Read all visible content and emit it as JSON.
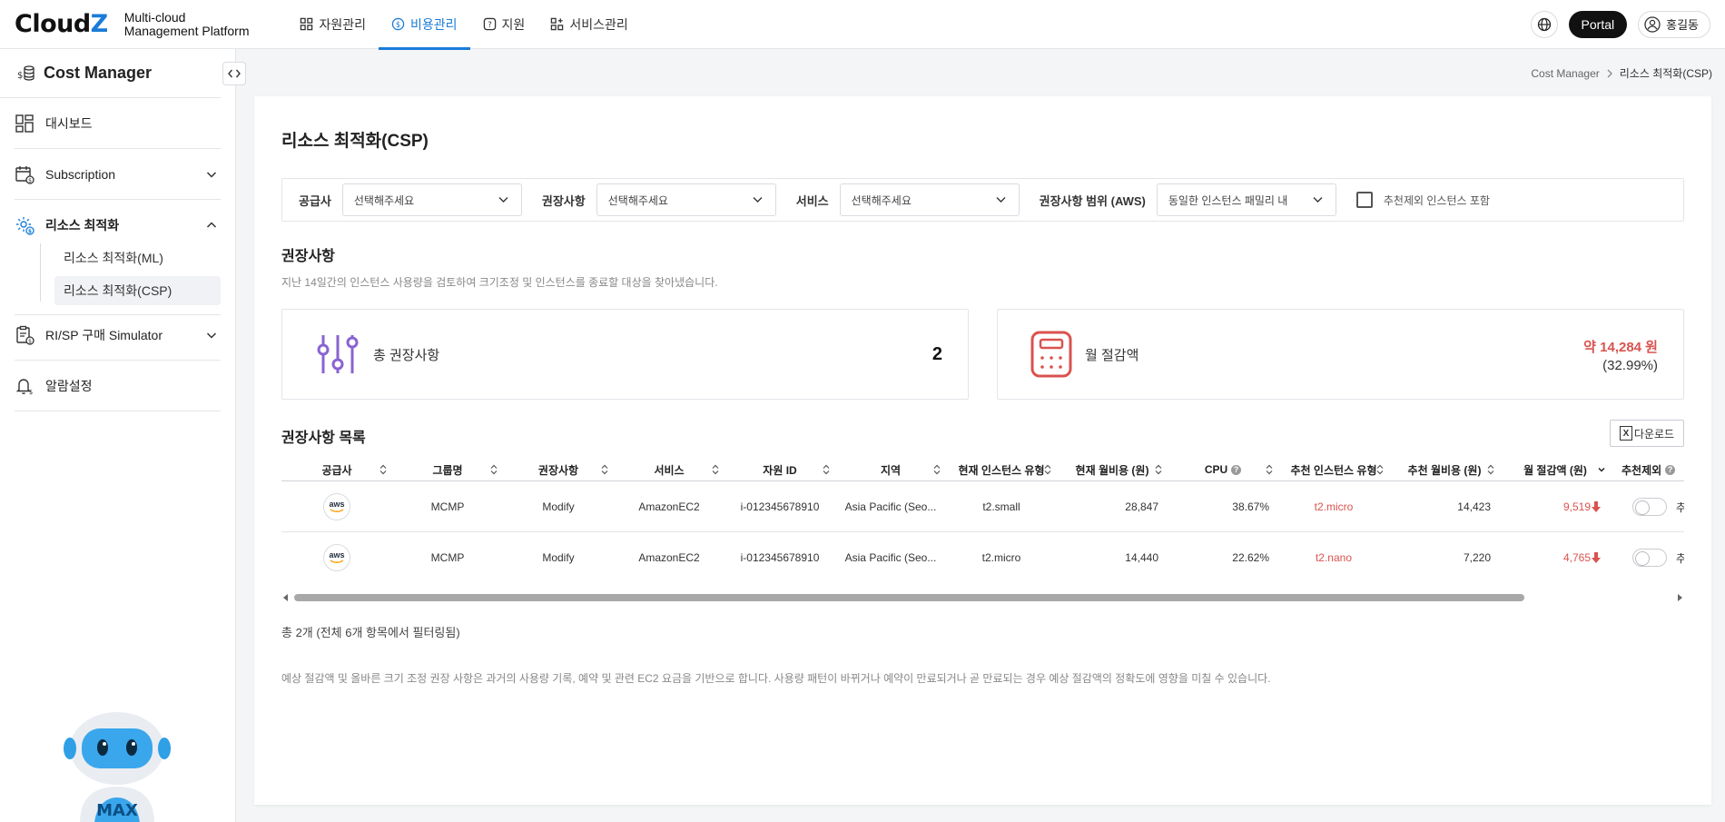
{
  "brand": {
    "logo_main": "Cloud",
    "logo_z": "Z",
    "sub_line1": "Multi-cloud",
    "sub_line2": "Management Platform"
  },
  "gnb": [
    {
      "label": "자원관리",
      "active": false
    },
    {
      "label": "비용관리",
      "active": true
    },
    {
      "label": "지원",
      "active": false
    },
    {
      "label": "서비스관리",
      "active": false
    }
  ],
  "top_right": {
    "portal": "Portal",
    "user": "홍길동"
  },
  "sidebar": {
    "title": "Cost Manager",
    "items": [
      {
        "label": "대시보드"
      },
      {
        "label": "Subscription"
      },
      {
        "label": "리소스 최적화"
      },
      {
        "label": "RI/SP 구매 Simulator"
      },
      {
        "label": "알람설정"
      }
    ],
    "sub_items": [
      "리소스 최적화(ML)",
      "리소스 최적화(CSP)"
    ],
    "mascot_label": "MAX"
  },
  "breadcrumb": {
    "root": "Cost Manager",
    "current": "리소스 최적화(CSP)"
  },
  "page": {
    "title": "리소스 최적화(CSP)",
    "filters": {
      "provider_label": "공급사",
      "provider_value": "선택해주세요",
      "reco_label": "권장사항",
      "reco_value": "선택해주세요",
      "service_label": "서비스",
      "service_value": "선택해주세요",
      "scope_label": "권장사항 범위 (AWS)",
      "scope_value": "동일한 인스턴스 패밀리 내",
      "exclude_label": "추천제외 인스턴스 포함"
    },
    "reco_section": {
      "title": "권장사항",
      "desc": "지난 14일간의 인스턴스 사용량을 검토하여 크기조정 및 인스턴스를 종료할 대상을 찾아냈습니다.",
      "total_label": "총 권장사항",
      "total_value": "2",
      "saving_label": "월 절감액",
      "saving_amount": "약 14,284 원",
      "saving_pct": "(32.99%)"
    },
    "list": {
      "title": "권장사항 목록",
      "download": "다운로드",
      "headers": [
        "공급사",
        "그룹명",
        "권장사항",
        "서비스",
        "자원 ID",
        "지역",
        "현재 인스턴스 유형",
        "현재 월비용 (원)",
        "CPU",
        "추천 인스턴스 유형",
        "추천 월비용 (원)",
        "월 절감액 (원)",
        "추천제외"
      ],
      "rows": [
        {
          "provider": "aws",
          "group": "MCMP",
          "reco": "Modify",
          "service": "AmazonEC2",
          "resource_id": "i-012345678910",
          "region": "Asia Pacific (Seo...",
          "cur_type": "t2.small",
          "cur_cost": "28,847",
          "cpu": "38.67%",
          "rec_type": "t2.micro",
          "rec_cost": "14,423",
          "saving": "9,519",
          "exclude_tail": "추"
        },
        {
          "provider": "aws",
          "group": "MCMP",
          "reco": "Modify",
          "service": "AmazonEC2",
          "resource_id": "i-012345678910",
          "region": "Asia Pacific (Seo...",
          "cur_type": "t2.micro",
          "cur_cost": "14,440",
          "cpu": "22.62%",
          "rec_type": "t2.nano",
          "rec_cost": "7,220",
          "saving": "4,765",
          "exclude_tail": "추"
        }
      ],
      "total_text": "총 2개 (전체 6개 항목에서 필터링됨)"
    },
    "note": "예상 절감액 및 올바른 크기 조정 권장 사항은 과거의 사용량 기록, 예약 및 관련 EC2 요금을 기반으로 합니다. 사용량 패턴이 바뀌거나 예약이 만료되거나 곧 만료되는 경우 예상 절감액의 정확도에 영향을 미칠 수 있습니다."
  },
  "colors": {
    "accent": "#1a7cd8",
    "saving_red": "#d9534f",
    "filter_purple": "#8a63d2",
    "calc_red": "#d9534f"
  }
}
